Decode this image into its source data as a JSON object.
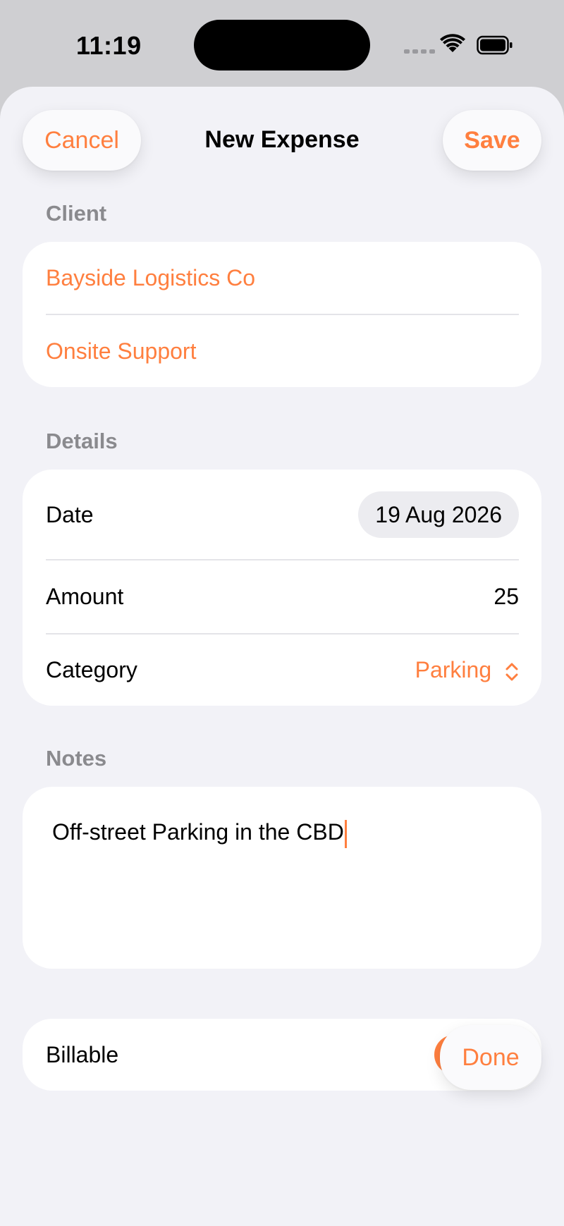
{
  "status_bar": {
    "time": "11:19"
  },
  "nav": {
    "title": "New Expense",
    "cancel_label": "Cancel",
    "save_label": "Save"
  },
  "client_section": {
    "header": "Client",
    "client_name": "Bayside Logistics Co",
    "project_name": "Onsite Support"
  },
  "details_section": {
    "header": "Details",
    "date_label": "Date",
    "date_value": "19 Aug 2026",
    "amount_label": "Amount",
    "amount_value": "25",
    "category_label": "Category",
    "category_value": "Parking"
  },
  "notes_section": {
    "header": "Notes",
    "text": "Off-street Parking in the CBD"
  },
  "billable": {
    "label": "Billable",
    "on": true
  },
  "keyboard_toolbar": {
    "done_label": "Done"
  },
  "colors": {
    "accent": "#ff7f3f",
    "background": "#f2f2f7",
    "card": "#ffffff",
    "secondary_text": "#8a8a8e"
  }
}
